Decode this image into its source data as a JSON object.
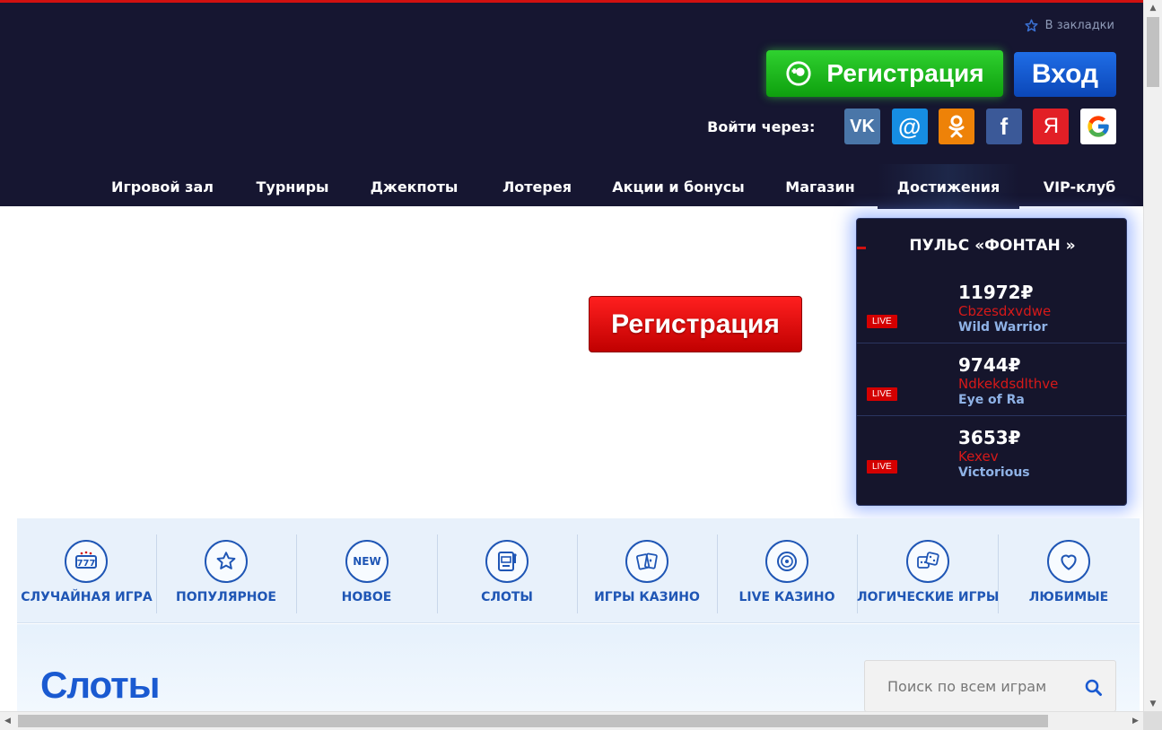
{
  "header": {
    "bookmark_label": "В закладки",
    "register_label": "Регистрация",
    "login_label": "Вход",
    "social_label": "Войти через:",
    "social": [
      {
        "name": "vk",
        "glyph": "VK",
        "color": "#4a76a8"
      },
      {
        "name": "mail",
        "glyph": "@",
        "color": "#168de2"
      },
      {
        "name": "ok",
        "glyph": "ok",
        "color": "#ee8208"
      },
      {
        "name": "facebook",
        "glyph": "f",
        "color": "#3b5998"
      },
      {
        "name": "yandex",
        "glyph": "Я",
        "color": "#e21f26"
      },
      {
        "name": "google",
        "glyph": "G",
        "color": "#ffffff"
      }
    ]
  },
  "nav": {
    "items": [
      {
        "label": "Игровой зал"
      },
      {
        "label": "Турниры"
      },
      {
        "label": "Джекпоты"
      },
      {
        "label": "Лотерея"
      },
      {
        "label": "Акции и бонусы"
      },
      {
        "label": "Магазин"
      },
      {
        "label": "Достижения",
        "active": true
      },
      {
        "label": "VIP-клуб"
      }
    ]
  },
  "promo": {
    "register_label": "Регистрация"
  },
  "pulse": {
    "title": "ПУЛЬС «ФОНТАН »",
    "live_label": "LIVE",
    "wins": [
      {
        "amount": "11972₽",
        "user": "Cbzesdxvdwe",
        "game": "Wild Warrior"
      },
      {
        "amount": "9744₽",
        "user": "Ndkekdsdlthve",
        "game": "Eye of Ra"
      },
      {
        "amount": "3653₽",
        "user": "Kexev",
        "game": "Victorious"
      }
    ]
  },
  "categories": [
    {
      "label": "СЛУЧАЙНАЯ ИГРА",
      "icon": "slot-777-icon"
    },
    {
      "label": "ПОПУЛЯРНОЕ",
      "icon": "star-icon"
    },
    {
      "label": "НОВОЕ",
      "icon": "new-badge-icon",
      "glyph": "NEW"
    },
    {
      "label": "СЛОТЫ",
      "icon": "slot-machine-icon"
    },
    {
      "label": "ИГРЫ КАЗИНО",
      "icon": "cards-icon"
    },
    {
      "label": "LIVE КАЗИНО",
      "icon": "roulette-icon"
    },
    {
      "label": "ЛОГИЧЕСКИЕ ИГРЫ",
      "icon": "dice-icon"
    },
    {
      "label": "ЛЮБИМЫЕ",
      "icon": "heart-icon"
    }
  ],
  "slots": {
    "title": "Слоты",
    "search_placeholder": "Поиск по всем играм"
  },
  "colors": {
    "header_bg": "#161631",
    "accent_red": "#d01010",
    "register_green": "#1bb81b",
    "login_blue": "#1458cc",
    "category_blue": "#1f56b5",
    "slots_title": "#1a5ad1"
  }
}
